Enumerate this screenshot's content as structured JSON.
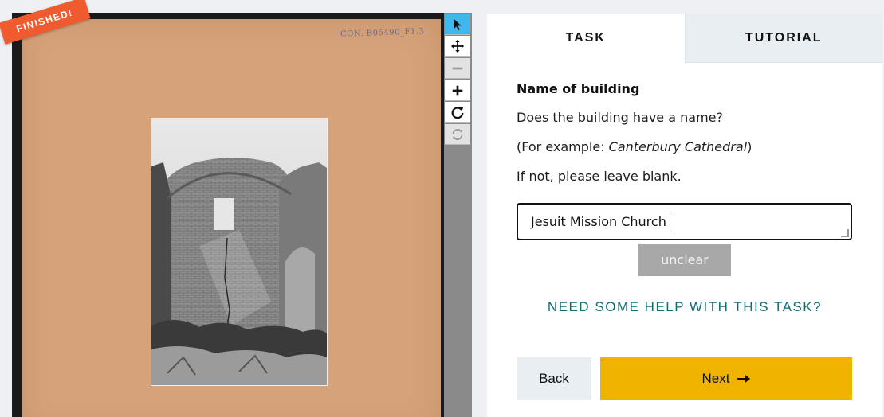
{
  "badge": {
    "text": "FINISHED!",
    "color": "#ef5a2e"
  },
  "subject": {
    "reference_note": "CON. B05490_F1.3",
    "image_description_icon": "photo-of-ruined-church-interior"
  },
  "toolbar": {
    "tools": [
      {
        "name": "annotate",
        "icon": "pointer-icon",
        "state": "active"
      },
      {
        "name": "move",
        "icon": "move-icon",
        "state": "enabled"
      },
      {
        "name": "zoom-out",
        "icon": "minus-icon",
        "state": "disabled"
      },
      {
        "name": "zoom-in",
        "icon": "plus-icon",
        "state": "enabled"
      },
      {
        "name": "rotate",
        "icon": "rotate-icon",
        "state": "enabled"
      },
      {
        "name": "reset",
        "icon": "refresh-icon",
        "state": "disabled"
      }
    ],
    "active_color": "#3fb7ef"
  },
  "tabs": {
    "task": "TASK",
    "tutorial": "TUTORIAL"
  },
  "task": {
    "title": "Name of building",
    "question": "Does the building have a name?",
    "example_prefix": "(For example: ",
    "example_italic": "Canterbury Cathedral",
    "example_suffix": ")",
    "instruction": "If not, please leave blank.",
    "answer_value": "Jesuit Mission Church",
    "unclear_label": "unclear",
    "help_link": "NEED SOME HELP WITH THIS TASK?",
    "back_label": "Back",
    "next_label": "Next",
    "next_icon": "arrow-right-icon",
    "colors": {
      "help": "#0d6f75",
      "next": "#f0b400",
      "unclear": "#a8a8a8"
    }
  }
}
